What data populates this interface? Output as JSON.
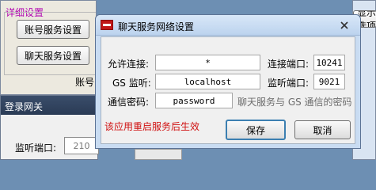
{
  "bg": {
    "group_legend": "详细设置",
    "account_button": "账号服务设置",
    "chat_button": "聊天服务设置",
    "right_tab_partial": "账号",
    "login_gateway_title": "登录网关",
    "listen_port_label": "监听端口:",
    "listen_port_value": "210",
    "right_top_btn_partial": "显示选项"
  },
  "dialog": {
    "app_icon": "app-icon",
    "title": "聊天服务网络设置",
    "close_icon": "close-icon",
    "allow_label": "允许连接:",
    "allow_value": "*",
    "connect_port_label": "连接端口:",
    "connect_port_value": "10241",
    "gs_listen_label": "GS 监听:",
    "gs_listen_value": "localhost",
    "listen_port_label": "监听端口:",
    "listen_port_value": "9021",
    "password_label": "通信密码:",
    "password_value": "password",
    "password_hint": "聊天服务与 GS 通信的密码",
    "restart_warning": "该应用重启服务后生效",
    "save_button": "保存",
    "cancel_button": "取消",
    "warning_color": "#d01010"
  }
}
